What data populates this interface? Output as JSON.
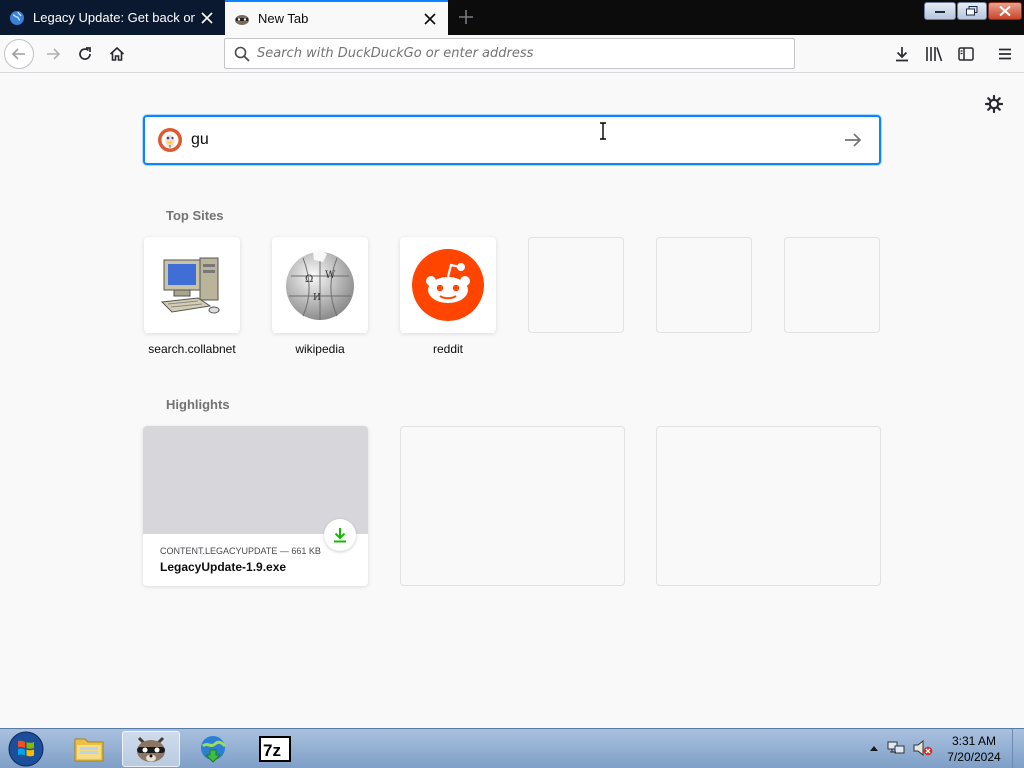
{
  "browser": {
    "tabs": [
      {
        "title": "Legacy Update: Get back online",
        "favicon": "globe-icon",
        "active": false
      },
      {
        "title": "New Tab",
        "favicon": "raccoon-icon",
        "active": true
      }
    ],
    "url_placeholder": "Search with DuckDuckGo or enter address"
  },
  "newtab": {
    "search_value": "gu",
    "top_sites_title": "Top Sites",
    "top_sites": [
      {
        "label": "search.collabnet",
        "icon": "computer-icon"
      },
      {
        "label": "wikipedia",
        "icon": "wikipedia-globe-icon"
      },
      {
        "label": "reddit",
        "icon": "reddit-icon"
      },
      {
        "label": "",
        "icon": ""
      },
      {
        "label": "",
        "icon": ""
      },
      {
        "label": "",
        "icon": ""
      }
    ],
    "highlights_title": "Highlights",
    "highlights": [
      {
        "meta": "CONTENT.LEGACYUPDATE — 661 KB",
        "filename": "LegacyUpdate-1.9.exe",
        "icon": "download-icon"
      }
    ]
  },
  "taskbar": {
    "apps": [
      "file-explorer-icon",
      "firefox-raccoon-icon",
      "download-manager-icon",
      "7zip-icon"
    ],
    "app_labels": {
      "sevenzip": "7z"
    },
    "clock_time": "3:31 AM",
    "clock_date": "7/20/2024"
  },
  "colors": {
    "accent": "#0a84ff",
    "reddit": "#ff4500",
    "download_green": "#12bc00"
  }
}
